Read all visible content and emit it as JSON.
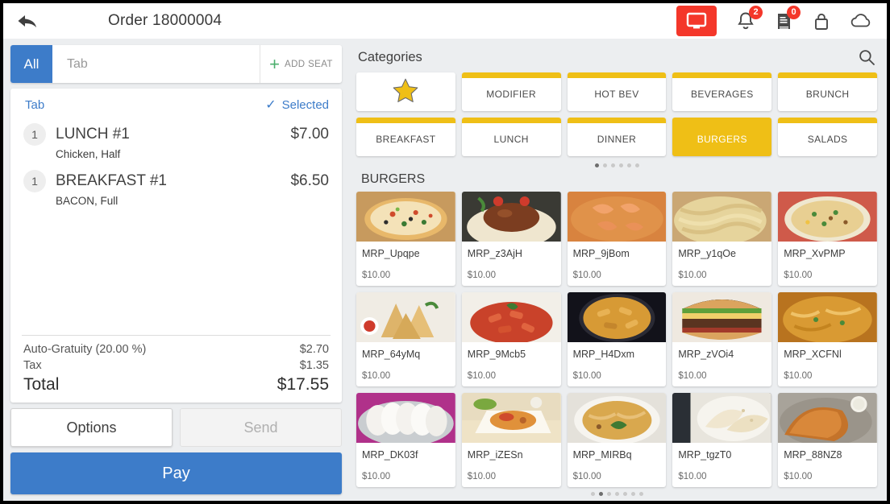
{
  "header": {
    "back_icon": "back-arrow-icon",
    "menu_icon": "hamburger-menu-icon",
    "title": "Order 18000004",
    "kds_icon": "monitor-icon",
    "kds_color": "#f4372a",
    "notifications_icon": "bell-icon",
    "notifications_badge": "2",
    "receipts_icon": "receipt-icon",
    "receipts_badge": "0",
    "lock_icon": "lock-icon",
    "cloud_icon": "cloud-icon"
  },
  "order_panel": {
    "seat_bar": {
      "all_label": "All",
      "tab_placeholder": "Tab",
      "add_seat_label": "ADD SEAT",
      "plus_icon": "plus-icon"
    },
    "tab_label": "Tab",
    "selected_label": "Selected",
    "check_icon": "check-icon",
    "items": [
      {
        "qty": "1",
        "name": "LUNCH #1",
        "price": "$7.00",
        "modifiers": "Chicken, Half"
      },
      {
        "qty": "1",
        "name": "BREAKFAST #1",
        "price": "$6.50",
        "modifiers": "BACON, Full"
      }
    ],
    "totals": [
      {
        "label": "Auto-Gratuity (20.00 %)",
        "value": "$2.70"
      },
      {
        "label": "Tax",
        "value": "$1.35"
      }
    ],
    "grand_total": {
      "label": "Total",
      "value": "$17.55"
    },
    "buttons": {
      "options": "Options",
      "send": "Send",
      "pay": "Pay"
    },
    "accent_blue": "#3d7cc9"
  },
  "catalog": {
    "categories_title": "Categories",
    "search_icon": "search-icon",
    "accent_yellow": "#efbf16",
    "categories": [
      {
        "label": "",
        "icon": "star-icon",
        "star": true,
        "active": false
      },
      {
        "label": "MODIFIER",
        "active": false
      },
      {
        "label": "HOT BEV",
        "active": false
      },
      {
        "label": "BEVERAGES",
        "active": false
      },
      {
        "label": "BRUNCH",
        "active": false
      },
      {
        "label": "BREAKFAST",
        "active": false
      },
      {
        "label": "LUNCH",
        "active": false
      },
      {
        "label": "DINNER",
        "active": false
      },
      {
        "label": "BURGERS",
        "active": true
      },
      {
        "label": "SALADS",
        "active": false
      }
    ],
    "category_pages": {
      "count": 6,
      "active_index": 0
    },
    "section_title": "BURGERS",
    "products": [
      {
        "name": "MRP_Upqpe",
        "price": "$10.00",
        "image": "pizza-photo"
      },
      {
        "name": "MRP_z3AjH",
        "price": "$10.00",
        "image": "spaghetti-bolognese-photo"
      },
      {
        "name": "MRP_9jBom",
        "price": "$10.00",
        "image": "shrimp-rice-photo"
      },
      {
        "name": "MRP_y1qOe",
        "price": "$10.00",
        "image": "creamy-pasta-photo"
      },
      {
        "name": "MRP_XvPMP",
        "price": "$10.00",
        "image": "fried-rice-photo"
      },
      {
        "name": "MRP_64yMq",
        "price": "$10.00",
        "image": "samosa-photo"
      },
      {
        "name": "MRP_9Mcb5",
        "price": "$10.00",
        "image": "penne-arrabiata-photo"
      },
      {
        "name": "MRP_H4Dxm",
        "price": "$10.00",
        "image": "pasta-pan-photo"
      },
      {
        "name": "MRP_zVOi4",
        "price": "$10.00",
        "image": "burger-photo"
      },
      {
        "name": "MRP_XCFNl",
        "price": "$10.00",
        "image": "biryani-photo"
      },
      {
        "name": "MRP_DK03f",
        "price": "$10.00",
        "image": "idli-photo"
      },
      {
        "name": "MRP_iZESn",
        "price": "$10.00",
        "image": "biryani-plate-photo"
      },
      {
        "name": "MRP_MIRBq",
        "price": "$10.00",
        "image": "pulao-photo"
      },
      {
        "name": "MRP_tgzT0",
        "price": "$10.00",
        "image": "roti-photo"
      },
      {
        "name": "MRP_88NZ8",
        "price": "$10.00",
        "image": "dosa-photo"
      }
    ],
    "product_pages": {
      "count": 7,
      "active_index": 1
    }
  }
}
